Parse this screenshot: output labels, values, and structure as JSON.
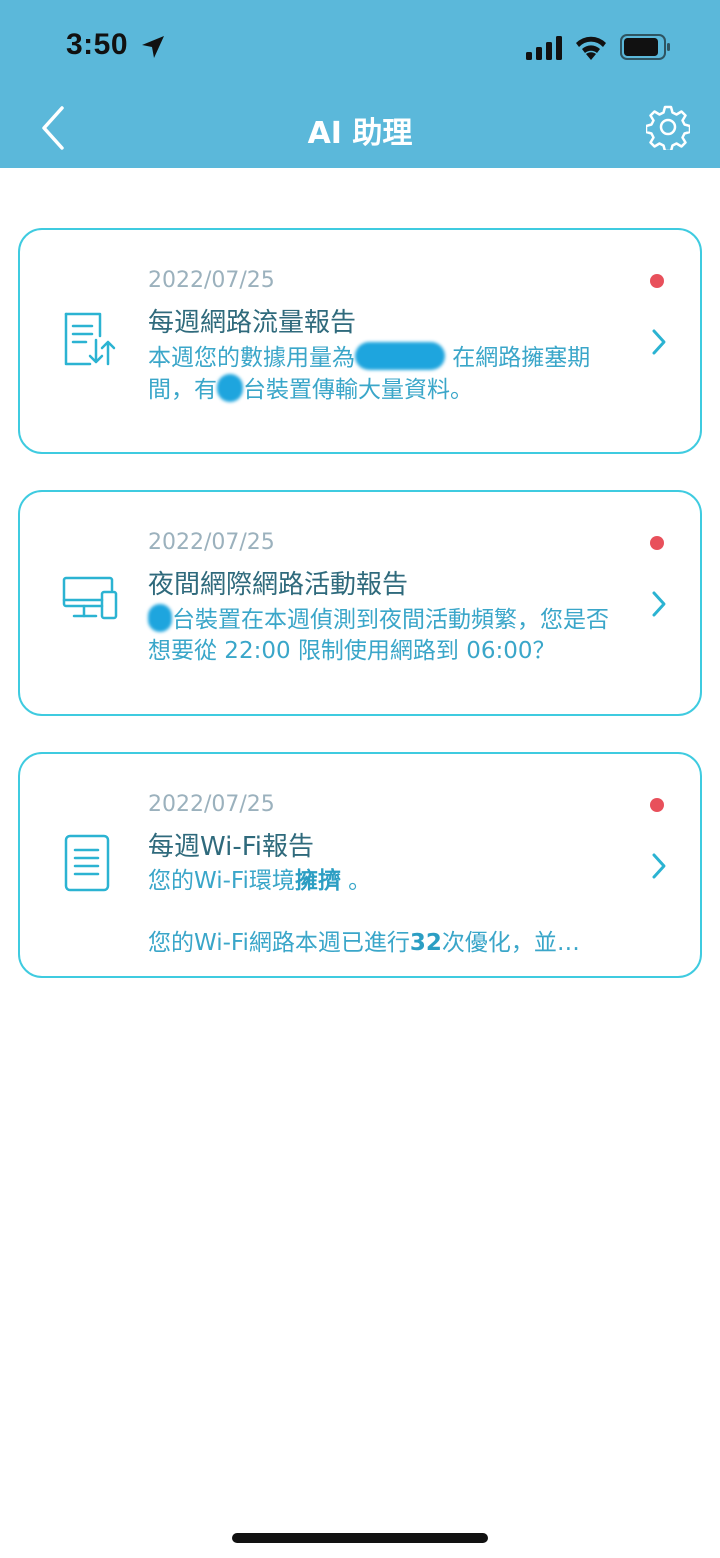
{
  "status_bar": {
    "time": "3:50"
  },
  "header": {
    "title": "AI 助理"
  },
  "cards": [
    {
      "date": "2022/07/25",
      "title": "每週網路流量報告",
      "desc_part1": "本週您的數據用量為",
      "desc_part2": " 在網路擁塞期間，有",
      "desc_part3": "台裝置傳輸大量資料。"
    },
    {
      "date": "2022/07/25",
      "title": "夜間網際網路活動報告",
      "desc_part1": "台裝置在本週偵測到夜間活動頻繁，您是否想要從 22:00 限制使用網路到 06:00？"
    },
    {
      "date": "2022/07/25",
      "title": "每週Wi-Fi報告",
      "line1_prefix": "您的Wi-Fi環境",
      "line1_strong": "擁擠",
      "line1_suffix": " 。",
      "line2_prefix": "您的Wi-Fi網路本週已進行",
      "line2_strong": "32",
      "line2_suffix": "次優化，並…"
    }
  ],
  "colors": {
    "header_bg": "#5bb8da",
    "card_border": "#3fcbe0",
    "unread_dot": "#e8505b"
  }
}
